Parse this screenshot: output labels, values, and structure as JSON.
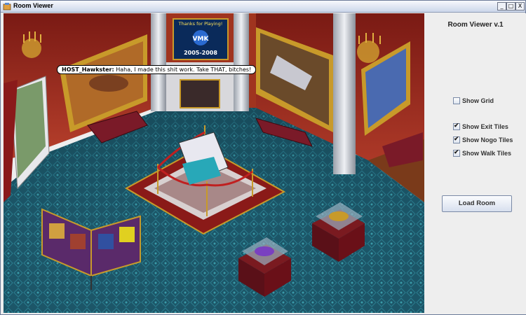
{
  "window": {
    "title": "Room Viewer",
    "controls": {
      "minimize": "_",
      "maximize": "□",
      "close": "X"
    }
  },
  "panel": {
    "title": "Room Viewer v.1",
    "checkboxes": [
      {
        "label": "Show Grid",
        "checked": false
      },
      {
        "label": "Show Exit Tiles",
        "checked": true
      },
      {
        "label": "Show Nogo Tiles",
        "checked": true
      },
      {
        "label": "Show Walk Tiles",
        "checked": true
      }
    ],
    "load_button": "Load Room"
  },
  "scene": {
    "chat": {
      "username": "HOST_Hawkster:",
      "message": " Haha, I made this shit work.  Take THAT, bitches!"
    },
    "banner": {
      "line1": "Thanks for Playing!",
      "logo": "VMK",
      "years": "2005-2008"
    },
    "colors": {
      "carpet": "#1c5a6a",
      "wall": "#b03020",
      "column": "#c8ccd4",
      "gold_frame": "#c89a2a",
      "bench": "#7a1a28"
    }
  }
}
